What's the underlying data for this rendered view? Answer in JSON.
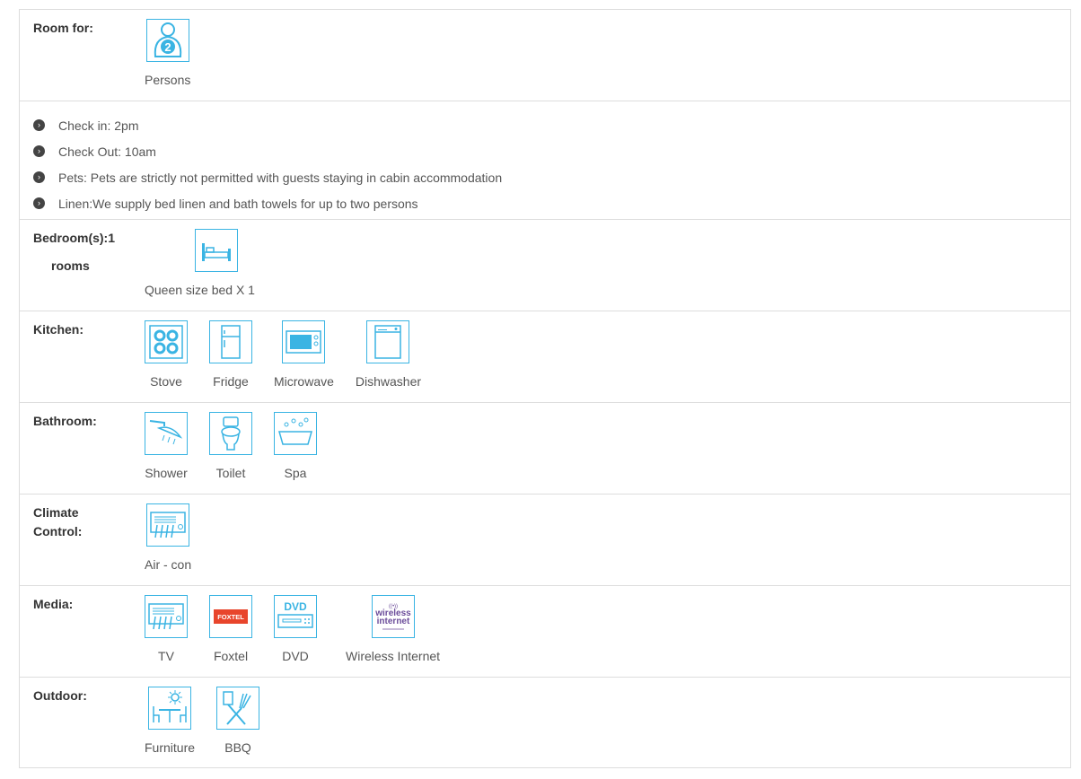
{
  "room_for": {
    "label": "Room for:",
    "icon": "person-2-icon",
    "caption": "Persons",
    "count": "2"
  },
  "rules": [
    "Check in: 2pm",
    "Check Out: 10am",
    "Pets: Pets are strictly not permitted with guests staying in cabin accommodation",
    "Linen:We supply bed linen and bath towels for up to two persons"
  ],
  "bedrooms": {
    "label": "Bedroom(s):1",
    "sub": "rooms",
    "items": [
      {
        "icon": "bed-icon",
        "caption": "Queen size bed X 1"
      }
    ]
  },
  "kitchen": {
    "label": "Kitchen:",
    "items": [
      {
        "icon": "stove-icon",
        "caption": "Stove"
      },
      {
        "icon": "fridge-icon",
        "caption": "Fridge"
      },
      {
        "icon": "microwave-icon",
        "caption": "Microwave"
      },
      {
        "icon": "dishwasher-icon",
        "caption": "Dishwasher"
      }
    ]
  },
  "bathroom": {
    "label": "Bathroom:",
    "items": [
      {
        "icon": "shower-icon",
        "caption": "Shower"
      },
      {
        "icon": "toilet-icon",
        "caption": "Toilet"
      },
      {
        "icon": "spa-icon",
        "caption": "Spa"
      }
    ]
  },
  "climate": {
    "label": "Climate Control:",
    "items": [
      {
        "icon": "air-con-icon",
        "caption": "Air - con"
      }
    ]
  },
  "media": {
    "label": "Media:",
    "items": [
      {
        "icon": "tv-icon",
        "caption": "TV"
      },
      {
        "icon": "foxtel-logo-icon",
        "caption": "Foxtel",
        "logo_text": "FOXTEL"
      },
      {
        "icon": "dvd-icon",
        "caption": "DVD",
        "logo_text": "DVD"
      },
      {
        "icon": "wireless-internet-icon",
        "caption": "Wireless Internet",
        "logo_text": "wireless internet"
      }
    ]
  },
  "outdoor": {
    "label": "Outdoor:",
    "items": [
      {
        "icon": "outdoor-furniture-icon",
        "caption": "Furniture"
      },
      {
        "icon": "bbq-icon",
        "caption": "BBQ"
      }
    ]
  },
  "colors": {
    "accent": "#3ab4e3",
    "border": "#dddddd",
    "text": "#555555",
    "label": "#333333"
  }
}
